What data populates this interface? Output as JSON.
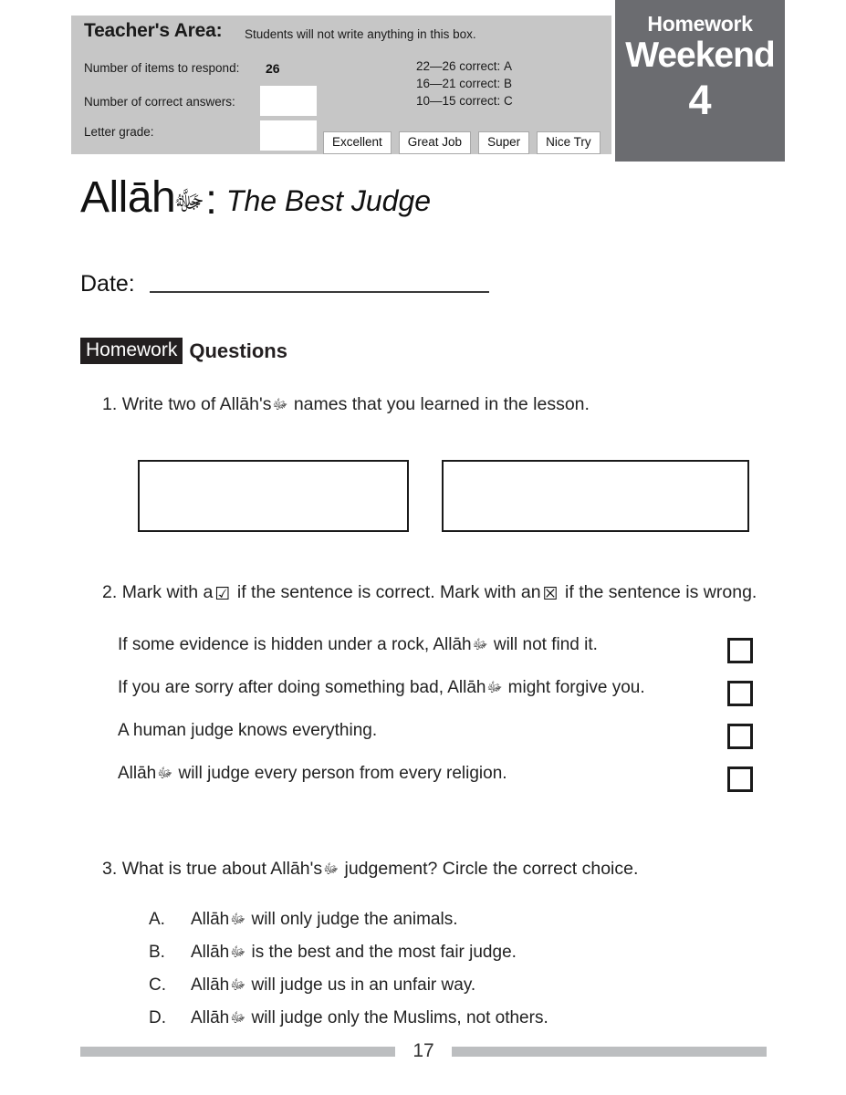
{
  "teacher_area": {
    "title": "Teacher's Area:",
    "note": "Students will not write anything in this box.",
    "label_items": "Number of items to respond:",
    "items_count": "26",
    "label_correct": "Number of correct answers:",
    "label_grade": "Letter grade:",
    "correct_value": "",
    "grade_value": "",
    "scale": [
      {
        "range": "22—26 correct:",
        "grade": "A"
      },
      {
        "range": "16—21 correct:",
        "grade": "B"
      },
      {
        "range": "10—15 correct:",
        "grade": "C"
      }
    ],
    "praise": [
      "Excellent",
      "Great Job",
      "Super",
      "Nice Try"
    ],
    "background_color": "#c6c6c6"
  },
  "badge": {
    "small": "Homework",
    "big": "Weekend",
    "number": "4",
    "background_color": "#6b6c70",
    "text_color": "#ffffff"
  },
  "title": {
    "allah": "Allāh",
    "swt_glyph": "ﷻ",
    "colon": ":",
    "subtitle": "The Best Judge"
  },
  "date": {
    "label": "Date:"
  },
  "section": {
    "tag": "Homework",
    "rest": "Questions",
    "tag_bg": "#231f20",
    "tag_fg": "#ffffff"
  },
  "questions": {
    "q1": {
      "number": "1.",
      "text_before": "Write two of Allāh's",
      "swt_glyph": "ﷻ",
      "text_after": "names that you learned in the lesson.",
      "answer_boxes": [
        "",
        ""
      ]
    },
    "q2": {
      "number": "2.",
      "part1": "Mark with a",
      "check_glyph": "☑",
      "part2": "if the sentence is correct. Mark with an",
      "x_glyph": "☒",
      "part3": "if the sentence is wrong.",
      "statements": [
        {
          "before": "If some evidence is hidden under a rock, Allāh",
          "swt_glyph": "ﷻ",
          "after": "will not find it.",
          "answer": ""
        },
        {
          "before": "If you are sorry after doing something bad, Allāh",
          "swt_glyph": "ﷻ",
          "after": "might forgive you.",
          "answer": ""
        },
        {
          "before": "A human judge knows everything.",
          "swt_glyph": "",
          "after": "",
          "answer": ""
        },
        {
          "before": "Allāh",
          "swt_glyph": "ﷻ",
          "after": "will judge every person from every religion.",
          "answer": ""
        }
      ]
    },
    "q3": {
      "number": "3.",
      "text_before": "What is true about Allāh's",
      "swt_glyph": "ﷻ",
      "text_after": "judgement? Circle the correct choice.",
      "options": [
        {
          "letter": "A.",
          "before": "Allāh",
          "swt_glyph": "ﷻ",
          "after": "will only judge the animals."
        },
        {
          "letter": "B.",
          "before": "Allāh",
          "swt_glyph": "ﷻ",
          "after": "is the best and the most fair judge."
        },
        {
          "letter": "C.",
          "before": "Allāh",
          "swt_glyph": "ﷻ",
          "after": "will judge us in an unfair way."
        },
        {
          "letter": "D.",
          "before": "Allāh",
          "swt_glyph": "ﷻ",
          "after": "will judge only the Muslims, not others."
        }
      ]
    }
  },
  "footer": {
    "page_number": "17",
    "bar_color": "#bcbec0"
  }
}
